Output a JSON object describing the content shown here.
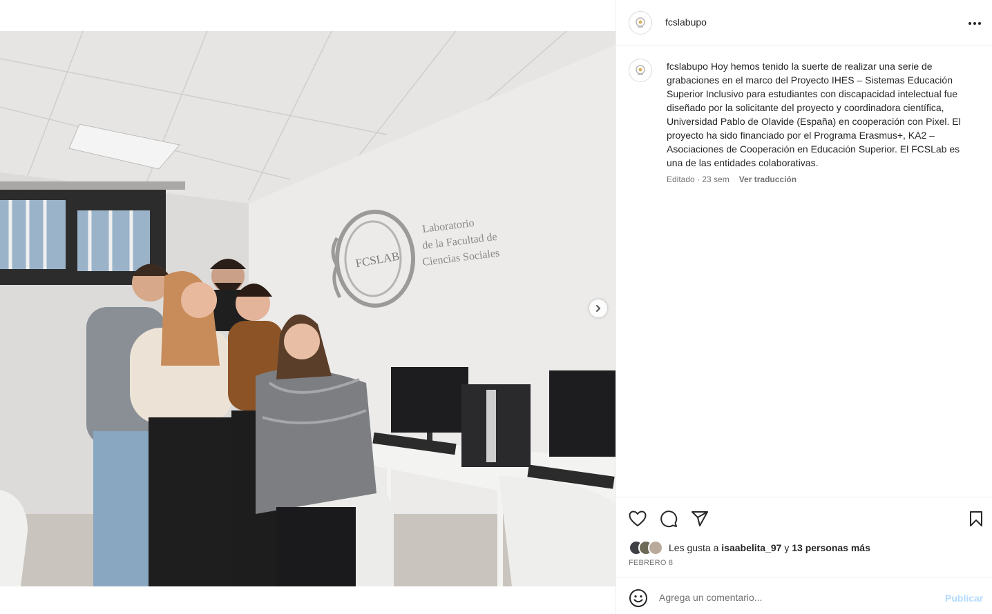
{
  "post": {
    "username": "fcslabupo",
    "caption_text": "Hoy hemos tenido la suerte de realizar una serie de grabaciones en el marco del Proyecto IHES – Sistemas Educación Superior Inclusivo para estudiantes con discapacidad intelectual fue diseñado por la solicitante del proyecto y coordinadora científica, Universidad Pablo de Olavide (España) en cooperación con Pixel. El proyecto ha sido financiado por el Programa Erasmus+, KA2 – Asociaciones de Cooperación en Educación Superior. El FCSLab es una de las entidades colaborativas.",
    "edited_label": "Editado · 23 sem",
    "translate_label": "Ver traducción",
    "date": "FEBRERO 8"
  },
  "photo": {
    "wall_logo_text": "FCSLAB",
    "wall_text_line1": "Laboratorio",
    "wall_text_line2": "de la Facultad de",
    "wall_text_line3": "Ciencias Sociales"
  },
  "likes": {
    "prefix": "Les gusta a",
    "user": "isaabelita_97",
    "joiner": "y",
    "others": "13 personas más"
  },
  "comment": {
    "placeholder": "Agrega un comentario...",
    "publish_label": "Publicar"
  },
  "icons": {
    "more": "more-horizontal-icon",
    "like": "heart-icon",
    "comment": "comment-bubble-icon",
    "share": "paper-plane-icon",
    "save": "bookmark-icon",
    "emoji": "smiley-icon",
    "next": "chevron-right-icon"
  }
}
